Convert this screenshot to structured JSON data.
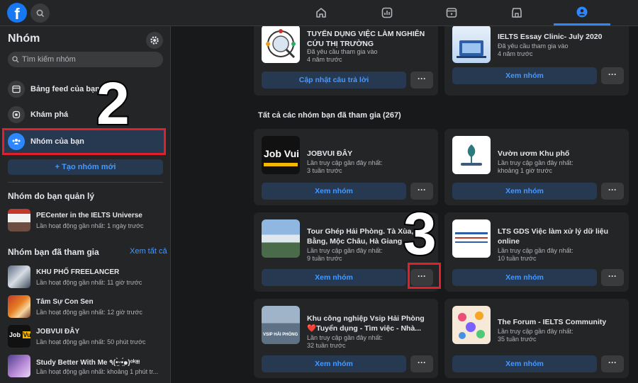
{
  "topbar": {
    "logo": "f",
    "nav": [
      "home-icon",
      "dashboard-icon",
      "watch-icon",
      "marketplace-icon",
      "groups-icon"
    ]
  },
  "sidebar": {
    "title": "Nhóm",
    "search_placeholder": "Tìm kiếm nhóm",
    "items": [
      {
        "label": "Bảng feed của bạn",
        "icon": "feed-icon"
      },
      {
        "label": "Khám phá",
        "icon": "compass-icon"
      },
      {
        "label": "Nhóm của bạn",
        "icon": "groups-icon"
      }
    ],
    "create_label": "+ Tạo nhóm mới",
    "managed_heading": "Nhóm do bạn quản lý",
    "managed": [
      {
        "name": "PECenter in the IELTS Universe",
        "sub": "Lần hoạt động gần nhất: 1 ngày trước"
      }
    ],
    "joined_heading": "Nhóm bạn đã tham gia",
    "see_all": "Xem tất cả",
    "joined": [
      {
        "name": "KHU PHỐ FREELANCER",
        "sub": "Lần hoạt động gần nhất: 11 giờ trước"
      },
      {
        "name": "Tâm Sự Con Sen",
        "sub": "Lần hoạt động gần nhất: 12 giờ trước"
      },
      {
        "name": "JOBVUI ĐÂY",
        "sub": "Lần hoạt động gần nhất: 50 phút trước"
      },
      {
        "name": "Study Better With Me ٩(•̤̀ᵕ•̤́๑)ᵒᵏᵎᵎᵎᵎ",
        "sub": "Lần hoạt động gần nhất: khoảng 1 phút tr..."
      }
    ]
  },
  "main": {
    "pending": [
      {
        "name": "TUYỂN DỤNG VIỆC LÀM NGHIÊN CỨU THỊ TRƯỜNG",
        "sub1": "Đã yêu cầu tham gia vào",
        "sub2": "4 năm trước",
        "button": "Cập nhật câu trả lời",
        "more": "···"
      },
      {
        "name": "IELTS Essay Clinic- July 2020",
        "sub1": "Đã yêu cầu tham gia vào",
        "sub2": "4 năm trước",
        "button": "Xem nhóm",
        "more": "···"
      }
    ],
    "all_heading": "Tất cả các nhóm bạn đã tham gia (267)",
    "groups": [
      {
        "name": "JOBVUI ĐÂY",
        "sub1": "Lần truy cập gần đây nhất:",
        "sub2": "3 tuần trước",
        "button": "Xem nhóm",
        "more": "···"
      },
      {
        "name": "Vườn ươm Khu phố",
        "sub1": "Lần truy cập gần đây nhất:",
        "sub2": "khoảng 1 giờ trước",
        "button": "Xem nhóm",
        "more": "···"
      },
      {
        "name": "Tour Ghép Hải Phòng. Tà Xùa, Cao Bằng, Mộc Châu, Hà Giang",
        "sub1": "Lần truy cập gần đây nhất:",
        "sub2": "9 tuần trước",
        "button": "Xem nhóm",
        "more": "···"
      },
      {
        "name": "LTS GDS Việc làm xử lý dữ liệu online",
        "sub1": "Lần truy cập gần đây nhất:",
        "sub2": "10 tuần trước",
        "button": "Xem nhóm",
        "more": "···"
      },
      {
        "name": "Khu công nghiệp Vsip Hải Phòng ❤️Tuyển dụng - Tìm việc - Nhà...",
        "sub1": "Lần truy cập gần đây nhất:",
        "sub2": "32 tuần trước",
        "button": "Xem nhóm",
        "more": "···"
      },
      {
        "name": "The Forum - IELTS Community",
        "sub1": "Lần truy cập gần đây nhất:",
        "sub2": "35 tuần trước",
        "button": "Xem nhóm",
        "more": "···"
      }
    ],
    "thumb_texts": {
      "jobvui": "Job Vui",
      "vsip": "VSIP HẢI PHÒNG"
    }
  },
  "annotations": {
    "two": "2",
    "three": "3"
  },
  "colors": {
    "accent": "#2d88ff",
    "red": "#e0202a",
    "bg": "#18191a",
    "card": "#242526"
  }
}
